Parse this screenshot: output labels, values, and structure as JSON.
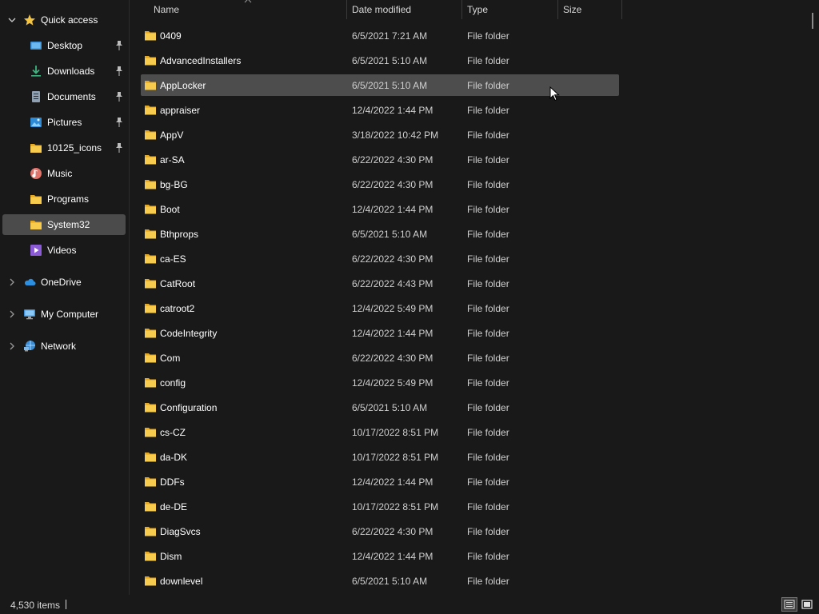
{
  "colors": {
    "background": "#191919",
    "selected_row": "#4d4d4d",
    "selected_nav": "#4b4b4b",
    "folder_yellow": "#f4c542",
    "text": "#ffffff",
    "muted_text": "#cfcfcf"
  },
  "sidebar": {
    "quick_access": {
      "label": "Quick access",
      "icon": "star-icon"
    },
    "items": [
      {
        "label": "Desktop",
        "icon": "desktop-icon",
        "pinned": true
      },
      {
        "label": "Downloads",
        "icon": "download-arrow-icon",
        "pinned": true
      },
      {
        "label": "Documents",
        "icon": "document-icon",
        "pinned": true
      },
      {
        "label": "Pictures",
        "icon": "picture-icon",
        "pinned": true
      },
      {
        "label": "10125_icons",
        "icon": "folder-icon",
        "pinned": true
      },
      {
        "label": "Music",
        "icon": "music-icon",
        "pinned": false
      },
      {
        "label": "Programs",
        "icon": "folder-icon",
        "pinned": false
      },
      {
        "label": "System32",
        "icon": "folder-icon",
        "pinned": false,
        "selected": true
      },
      {
        "label": "Videos",
        "icon": "video-icon",
        "pinned": false
      }
    ],
    "roots": [
      {
        "label": "OneDrive",
        "icon": "cloud-icon"
      },
      {
        "label": "My Computer",
        "icon": "computer-icon"
      },
      {
        "label": "Network",
        "icon": "network-icon"
      }
    ]
  },
  "columns": {
    "name": "Name",
    "date_modified": "Date modified",
    "type": "Type",
    "size": "Size"
  },
  "files": [
    {
      "name": "0409",
      "date": "6/5/2021 7:21 AM",
      "type": "File folder"
    },
    {
      "name": "AdvancedInstallers",
      "date": "6/5/2021 5:10 AM",
      "type": "File folder"
    },
    {
      "name": "AppLocker",
      "date": "6/5/2021 5:10 AM",
      "type": "File folder",
      "selected": true
    },
    {
      "name": "appraiser",
      "date": "12/4/2022 1:44 PM",
      "type": "File folder"
    },
    {
      "name": "AppV",
      "date": "3/18/2022 10:42 PM",
      "type": "File folder"
    },
    {
      "name": "ar-SA",
      "date": "6/22/2022 4:30 PM",
      "type": "File folder"
    },
    {
      "name": "bg-BG",
      "date": "6/22/2022 4:30 PM",
      "type": "File folder"
    },
    {
      "name": "Boot",
      "date": "12/4/2022 1:44 PM",
      "type": "File folder"
    },
    {
      "name": "Bthprops",
      "date": "6/5/2021 5:10 AM",
      "type": "File folder"
    },
    {
      "name": "ca-ES",
      "date": "6/22/2022 4:30 PM",
      "type": "File folder"
    },
    {
      "name": "CatRoot",
      "date": "6/22/2022 4:43 PM",
      "type": "File folder"
    },
    {
      "name": "catroot2",
      "date": "12/4/2022 5:49 PM",
      "type": "File folder"
    },
    {
      "name": "CodeIntegrity",
      "date": "12/4/2022 1:44 PM",
      "type": "File folder"
    },
    {
      "name": "Com",
      "date": "6/22/2022 4:30 PM",
      "type": "File folder"
    },
    {
      "name": "config",
      "date": "12/4/2022 5:49 PM",
      "type": "File folder"
    },
    {
      "name": "Configuration",
      "date": "6/5/2021 5:10 AM",
      "type": "File folder"
    },
    {
      "name": "cs-CZ",
      "date": "10/17/2022 8:51 PM",
      "type": "File folder"
    },
    {
      "name": "da-DK",
      "date": "10/17/2022 8:51 PM",
      "type": "File folder"
    },
    {
      "name": "DDFs",
      "date": "12/4/2022 1:44 PM",
      "type": "File folder"
    },
    {
      "name": "de-DE",
      "date": "10/17/2022 8:51 PM",
      "type": "File folder"
    },
    {
      "name": "DiagSvcs",
      "date": "6/22/2022 4:30 PM",
      "type": "File folder"
    },
    {
      "name": "Dism",
      "date": "12/4/2022 1:44 PM",
      "type": "File folder"
    },
    {
      "name": "downlevel",
      "date": "6/5/2021 5:10 AM",
      "type": "File folder"
    }
  ],
  "status": {
    "item_count": "4,530 items",
    "views": [
      "details-view-icon",
      "large-icons-view-icon"
    ],
    "active_view": "details-view-icon"
  }
}
